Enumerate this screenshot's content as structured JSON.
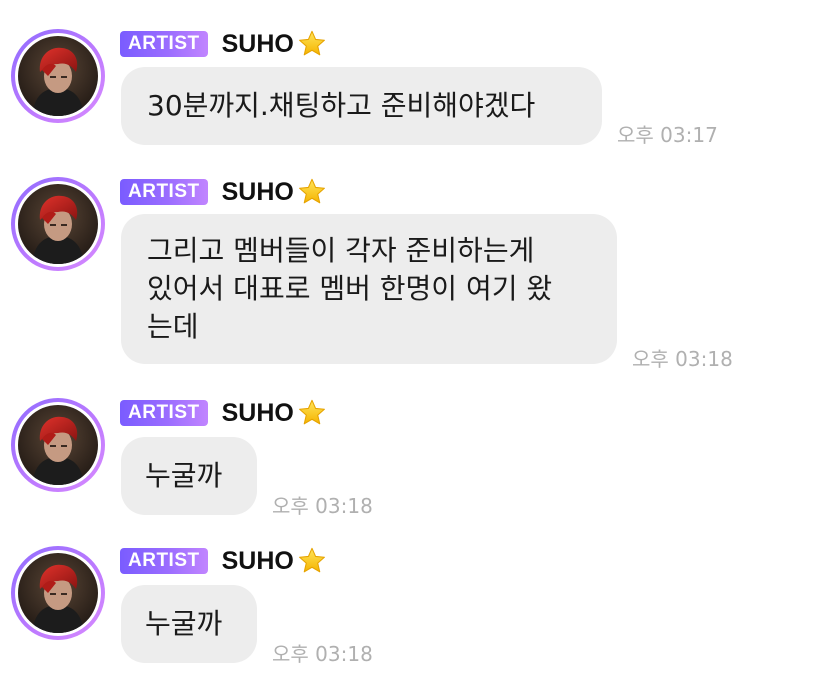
{
  "messages": [
    {
      "badge": "ARTIST",
      "sender": "SUHO",
      "text": "30분까지.채팅하고 준비해야겠다",
      "time": "오후 03:17"
    },
    {
      "badge": "ARTIST",
      "sender": "SUHO",
      "text": "그리고 멤버들이 각자 준비하는게\n있어서 대표로 멤버 한명이 여기 왔\n는데",
      "time": "오후 03:18"
    },
    {
      "badge": "ARTIST",
      "sender": "SUHO",
      "text": "누굴까",
      "time": "오후 03:18"
    },
    {
      "badge": "ARTIST",
      "sender": "SUHO",
      "text": "누굴까",
      "time": "오후 03:18"
    }
  ],
  "icons": {
    "star": "star-icon",
    "avatar": "profile-photo"
  },
  "colors": {
    "badge_gradient_start": "#7a5cff",
    "badge_gradient_end": "#c185ff",
    "bubble_bg": "#ededed",
    "timestamp": "#b0b0b0",
    "avatar_ring": "#9b6dff"
  }
}
